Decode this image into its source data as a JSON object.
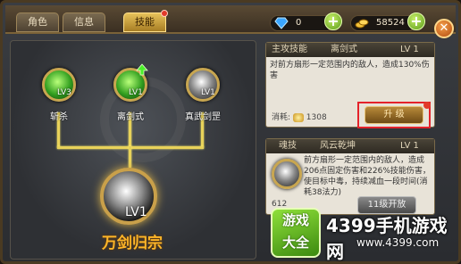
{
  "tabs": [
    {
      "label": "角色"
    },
    {
      "label": "信息"
    },
    {
      "label": "技能"
    }
  ],
  "resources": {
    "diamonds": "0",
    "gold": "58524"
  },
  "skill_tree": {
    "nodes": [
      {
        "name": "斩杀",
        "level": "LV3",
        "icon": "green-vortex"
      },
      {
        "name": "离剑式",
        "level": "LV1",
        "icon": "green-vortex-arrow"
      },
      {
        "name": "真武剑罡",
        "level": "LV1",
        "icon": "grey-vortex"
      }
    ],
    "ultimate": {
      "name": "万剑归宗",
      "level": "LV1"
    }
  },
  "main_skill": {
    "type": "主攻技能",
    "name": "离剑式",
    "level": "LV 1",
    "description": "对前方扇形一定范围内的敌人，造成130%伤害",
    "cost_label": "消耗:",
    "cost": "1308",
    "upgrade_label": "升 级"
  },
  "soul_skill": {
    "type": "魂技",
    "name": "风云乾坤",
    "level": "LV 1",
    "description": "前方扇形一定范围内的敌人，造成206点固定伤害和226%技能伤害，使目标中毒，持续减血一段时间(消耗38法力)",
    "cost_partial": "612",
    "unlock_label": "11级开放"
  },
  "watermark": {
    "logo_line1": "游戏",
    "logo_line2": "大全",
    "title": "4399手机游戏网",
    "url": "www.4399.com"
  },
  "colors": {
    "accent": "#e7c25a",
    "highlight_box": "#e4222a",
    "ultimate_text": "#ffb628"
  }
}
